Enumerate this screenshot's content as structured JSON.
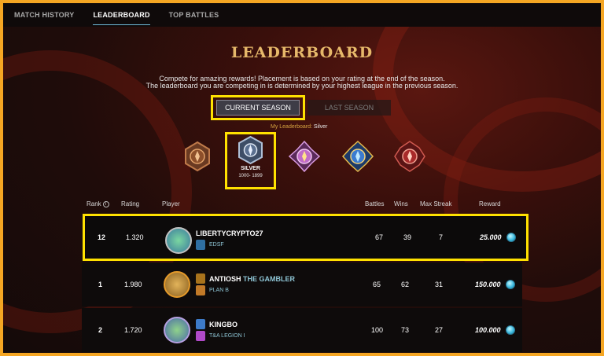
{
  "nav": {
    "items": [
      "MATCH HISTORY",
      "LEADERBOARD",
      "TOP BATTLES"
    ],
    "active": 1
  },
  "page": {
    "title": "LEADERBOARD",
    "desc_line1": "Compete for amazing rewards! Placement is based on your rating at the end of the season.",
    "desc_line2": "The leaderboard you are competing in is determined by your highest league in the previous season."
  },
  "season": {
    "current_label": "CURRENT SEASON",
    "last_label": "LAST SEASON"
  },
  "my_league": {
    "label": "My Leaderboard:",
    "value": "Silver"
  },
  "leagues": {
    "selected_name": "SILVER",
    "selected_range": "1000- 1899",
    "icons": [
      "bronze-league-icon",
      "silver-league-icon",
      "gold-league-icon",
      "diamond-league-icon",
      "champion-league-icon"
    ]
  },
  "table": {
    "headers": {
      "rank": "Rank",
      "rating": "Rating",
      "player": "Player",
      "battles": "Battles",
      "wins": "Wins",
      "max_streak": "Max Streak",
      "reward": "Reward"
    },
    "rows": [
      {
        "rank": "12",
        "rating": "1.320",
        "player": "LIBERTYCRYPTO27",
        "title": "",
        "guild": "EDSF",
        "battles": "67",
        "wins": "39",
        "streak": "7",
        "reward": "25.000"
      },
      {
        "rank": "1",
        "rating": "1.980",
        "player": "ANTIOSH",
        "title": "THE GAMBLER",
        "guild": "PLAN B",
        "battles": "65",
        "wins": "62",
        "streak": "31",
        "reward": "150.000"
      },
      {
        "rank": "2",
        "rating": "1.720",
        "player": "KINGBO",
        "title": "",
        "guild": "T&A LEGION I",
        "battles": "100",
        "wins": "73",
        "streak": "27",
        "reward": "100.000"
      }
    ]
  },
  "colors": {
    "accent_gold": "#e6b86a",
    "highlight": "#ffe100",
    "guild_text": "#8fc6d6",
    "reward_coin": "#36b6dc"
  }
}
